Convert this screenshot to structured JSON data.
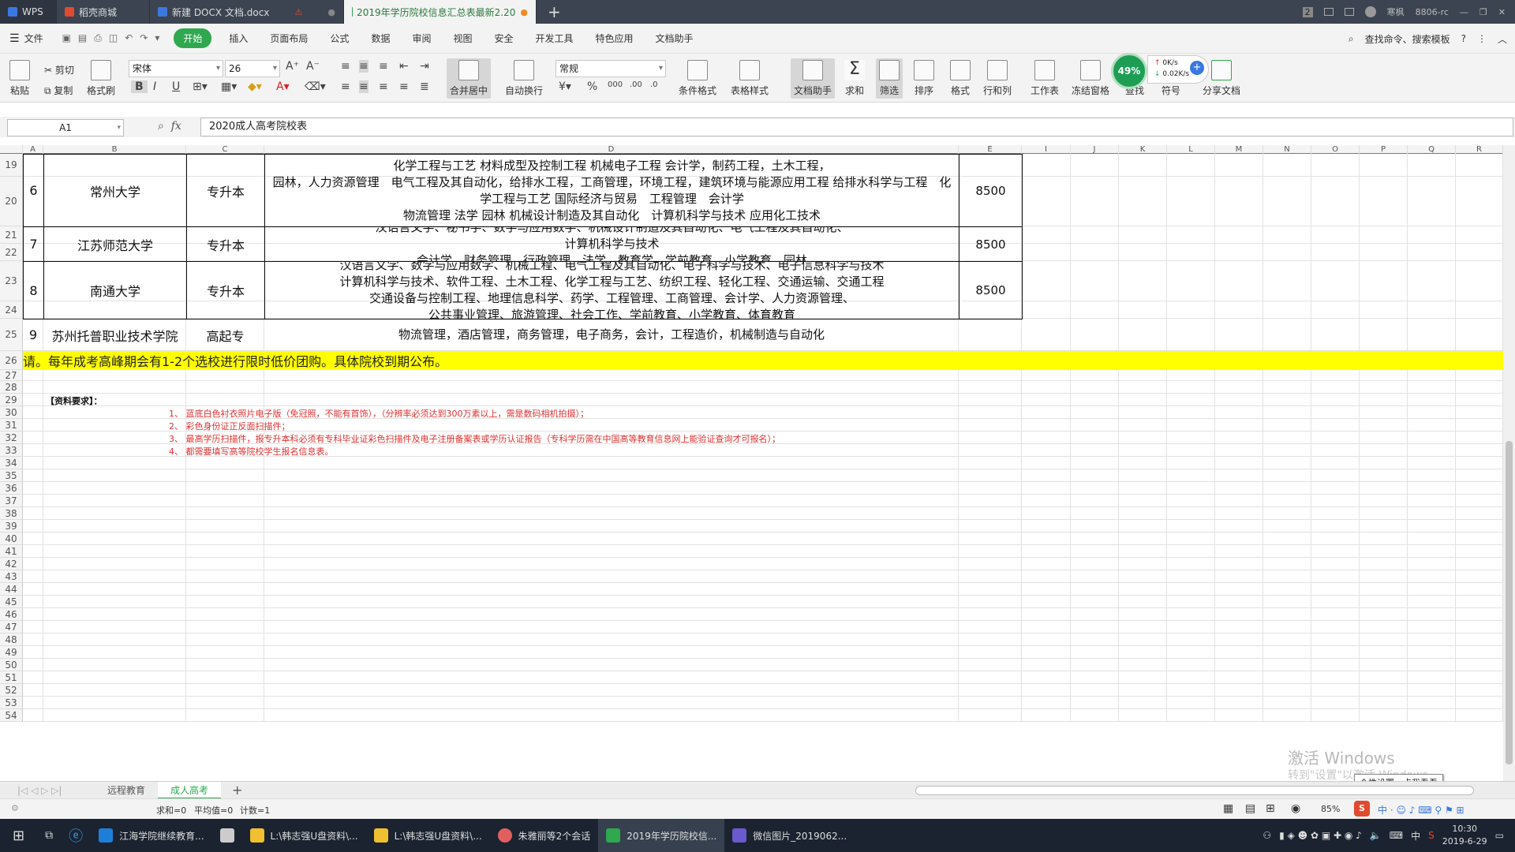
{
  "tabs": [
    {
      "label": "WPS",
      "color": "#3a78e0"
    },
    {
      "label": "稻壳商城",
      "color": "#e04a2f"
    },
    {
      "label": "新建 DOCX 文档.docx",
      "color": "#3a78e0"
    },
    {
      "label": "2019年学历院校信息汇总表最新2.20",
      "color": "#2fa84f"
    }
  ],
  "tab_add": "+",
  "topright": {
    "number": "2",
    "user": "寒枫",
    "account": "8806-rc"
  },
  "menu": {
    "file": "文件",
    "items": [
      "开始",
      "插入",
      "页面布局",
      "公式",
      "数据",
      "审阅",
      "视图",
      "安全",
      "开发工具",
      "特色应用",
      "文档助手"
    ],
    "search": "查找命令、搜索模板"
  },
  "ribbon": {
    "paste": "粘贴",
    "cut": "剪切",
    "copy": "复制",
    "format_painter": "格式刷",
    "font": "宋体",
    "size": "26",
    "merge": "合并居中",
    "wrap": "自动换行",
    "number_format": "常规",
    "cond_format": "条件格式",
    "table_style": "表格样式",
    "doc_assistant": "文档助手",
    "sum": "求和",
    "filter": "筛选",
    "sort": "排序",
    "format": "格式",
    "rowcol": "行和列",
    "sheet": "工作表",
    "freeze": "冻结窗格",
    "find": "查找",
    "symbol": "符号",
    "share": "分享文档"
  },
  "gauge": {
    "percent": "49%",
    "up": "0K/s",
    "down": "0.02K/s"
  },
  "formula_bar": {
    "cell": "A1",
    "content": "2020成人高考院校表"
  },
  "columns": [
    "A",
    "B",
    "C",
    "D",
    "E",
    "I",
    "J",
    "K",
    "L",
    "M",
    "N",
    "O",
    "P",
    "Q",
    "R"
  ],
  "rows": {
    "start": 19,
    "end": 54
  },
  "table": [
    {
      "no": "6",
      "school": "常州大学",
      "level": "专升本",
      "majors": [
        "化学工程与工艺 材料成型及控制工程 机械电子工程 会计学，制药工程，土木工程，",
        "园林，人力资源管理　电气工程及其自动化，给排水工程，工商管理，环境工程，建筑环境与能源应用工程 给排水科学与工程　化学工程与工艺 国际经济与贸易　工程管理　会计学",
        "物流管理 法学 园林 机械设计制造及其自动化　计算机科学与技术 应用化工技术"
      ],
      "fee": "8500"
    },
    {
      "no": "7",
      "school": "江苏师范大学",
      "level": "专升本",
      "majors": [
        "汉语言文学、秘书学、数学与应用数学、机械设计制造及其自动化、电气工程及其自动化、",
        "计算机科学与技术",
        "会计学、财务管理、行政管理、法学、教育学、学前教育、小学教育、园林"
      ],
      "fee": "8500"
    },
    {
      "no": "8",
      "school": "南通大学",
      "level": "专升本",
      "majors": [
        "汉语言文学、数学与应用数学、机械工程、电气工程及其自动化、电子科学与技术、电子信息科学与技术",
        "计算机科学与技术、软件工程、土木工程、化学工程与工艺、纺织工程、轻化工程、交通运输、交通工程",
        "交通设备与控制工程、地理信息科学、药学、工程管理、工商管理、会计学、人力资源管理、",
        "公共事业管理、旅游管理、社会工作、学前教育、小学教育、体育教育"
      ],
      "fee": "8500"
    },
    {
      "no": "9",
      "school": "苏州托普职业技术学院",
      "level": "高起专",
      "majors": [
        "物流管理，酒店管理，商务管理，电子商务，会计，工程造价，机械制造与自动化"
      ],
      "fee": ""
    }
  ],
  "notice": "请。每年成考高峰期会有1-2个选校进行限时低价团购。具体院校到期公布。",
  "requirements": {
    "title": "【资料要求】：",
    "items": [
      "1、 蓝底白色衬衣照片电子版（免冠照，不能有首饰），（分辨率必须达到300万素以上，需是数码相机拍摄）；",
      "2、 彩色身份证正反面扫描件；",
      "3、 最高学历扫描件，报专升本科必须有专科毕业证彩色扫描件及电子注册备案表或学历认证报告（专科学历需在中国高等教育信息网上能验证查询才可报名）；",
      "4、 都需要填写高等院校学生报名信息表。"
    ]
  },
  "watermark": {
    "line1": "激活 Windows",
    "line2": "转到\"设置\"以激活 Windows。"
  },
  "tooltip": "个性设置，点我看看",
  "sheets": [
    "远程教育",
    "成人高考"
  ],
  "status": {
    "sum": "求和=0",
    "avg": "平均值=0",
    "count": "计数=1",
    "zoom": "85%"
  },
  "taskbar": [
    {
      "label": "江海学院继续教育...",
      "color": "#1e7fd8"
    },
    {
      "label": "",
      "color": "#cccccc"
    },
    {
      "label": "L:\\韩志强U盘资料\\...",
      "color": "#f0c030"
    },
    {
      "label": "L:\\韩志强U盘资料\\...",
      "color": "#f0c030"
    },
    {
      "label": "朱雅丽等2个会话",
      "color": "#e06060"
    },
    {
      "label": "2019年学历院校信...",
      "color": "#2fa84f"
    },
    {
      "label": "微信图片_2019062...",
      "color": "#6a5acd"
    }
  ],
  "clock": {
    "time": "10:30",
    "date": "2019-6-29",
    "ime": "中"
  }
}
